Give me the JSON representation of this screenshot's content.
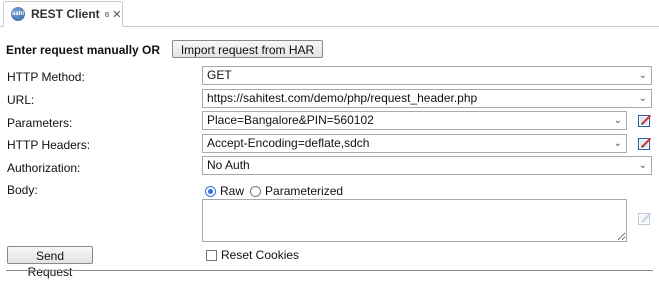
{
  "tab": {
    "title": "REST Client",
    "icon_text": "sahi",
    "detach_glyph": "ɞ",
    "close_glyph": "✕"
  },
  "intro": {
    "label": "Enter request manually OR",
    "import_button": "Import request from HAR"
  },
  "form": {
    "method_label": "HTTP Method:",
    "method_value": "GET",
    "url_label": "URL:",
    "url_value": "https://sahitest.com/demo/php/request_header.php",
    "params_label": "Parameters:",
    "params_value": "Place=Bangalore&PIN=560102",
    "headers_label": "HTTP Headers:",
    "headers_value": "Accept-Encoding=deflate,sdch",
    "auth_label": "Authorization:",
    "auth_value": "No Auth",
    "body_label": "Body:",
    "body_mode_raw": "Raw",
    "body_mode_param": "Parameterized",
    "body_selected": "Raw",
    "body_value": ""
  },
  "actions": {
    "send_button": "Send Request",
    "reset_cookies_label": "Reset Cookies",
    "reset_cookies_checked": false
  },
  "icons": {
    "chevron": "⌄",
    "edit": "edit-pencil-icon"
  },
  "colors": {
    "radio_accent": "#2f6fdf",
    "edit_icon_blue": "#2a5aa8",
    "edit_icon_red": "#d23a2a"
  }
}
